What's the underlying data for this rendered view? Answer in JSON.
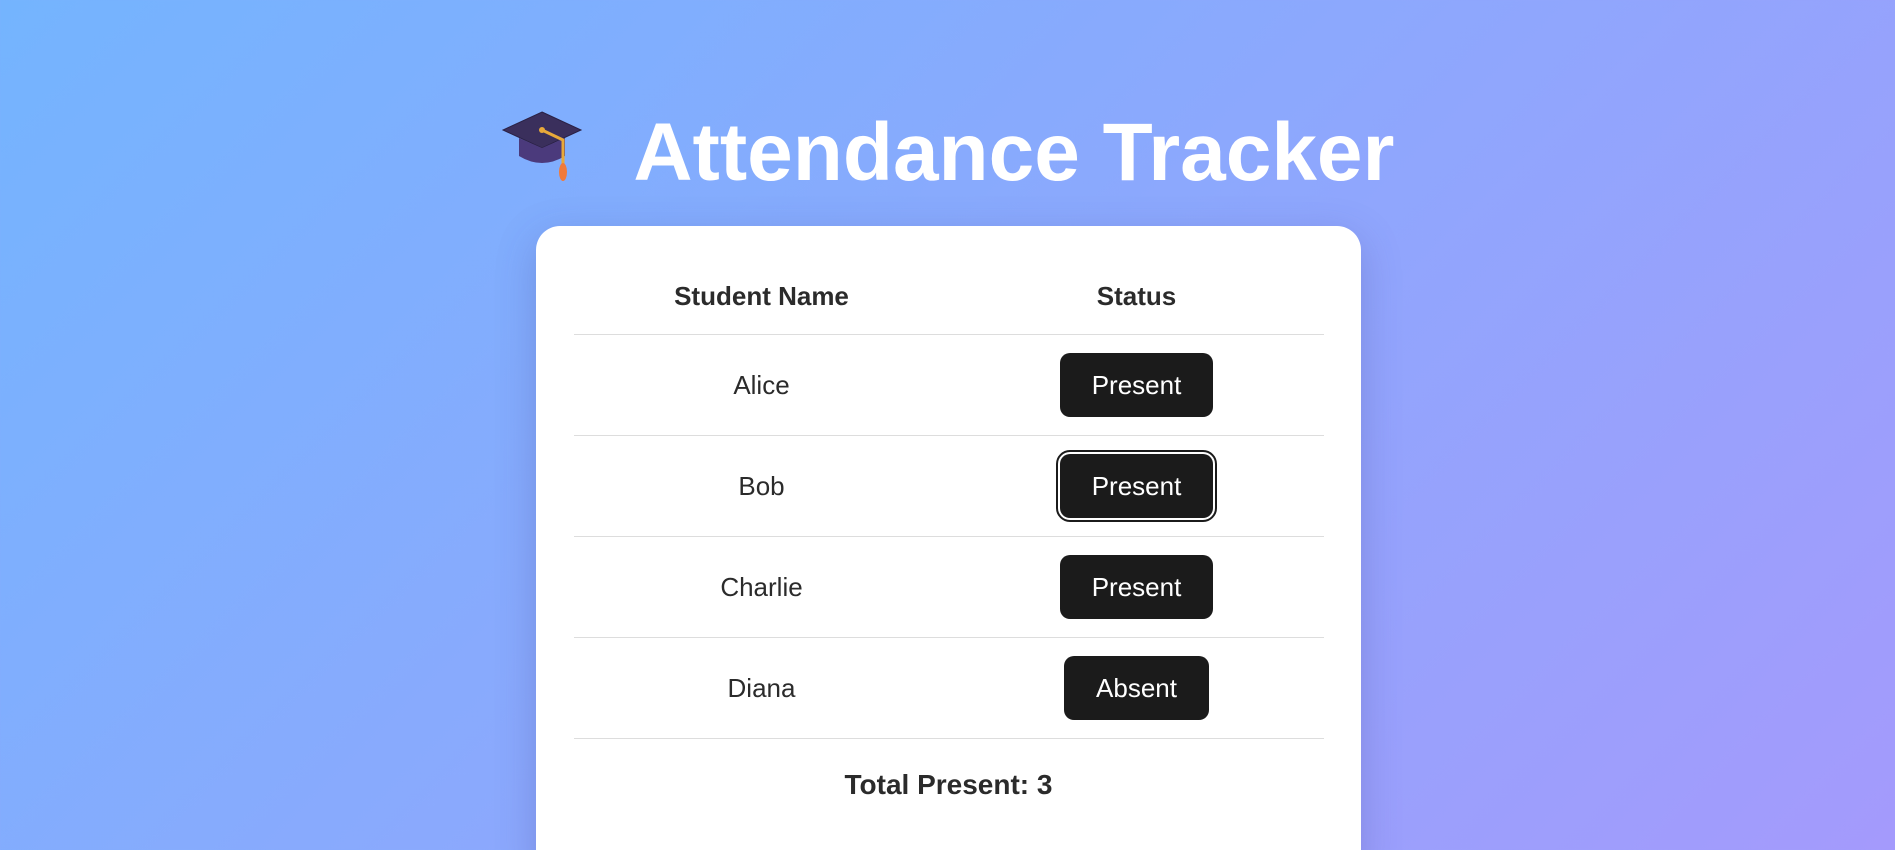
{
  "header": {
    "icon": "graduation-cap-icon",
    "title": "Attendance Tracker"
  },
  "table": {
    "columns": [
      "Student Name",
      "Status"
    ],
    "rows": [
      {
        "name": "Alice",
        "status": "Present"
      },
      {
        "name": "Bob",
        "status": "Present"
      },
      {
        "name": "Charlie",
        "status": "Present"
      },
      {
        "name": "Diana",
        "status": "Absent"
      }
    ]
  },
  "summary": {
    "total_label": "Total Present: 3"
  },
  "colors": {
    "background_start": "#74b4fe",
    "background_end": "#a49afc",
    "button_bg": "#1b1b1b",
    "button_text": "#ffffff",
    "card_bg": "#ffffff"
  }
}
